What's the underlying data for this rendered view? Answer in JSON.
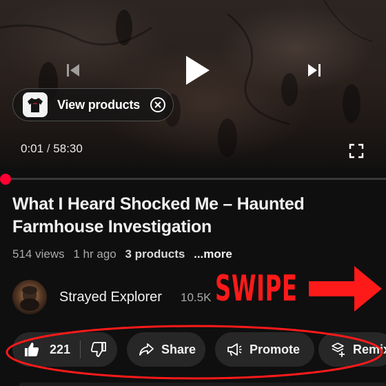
{
  "player": {
    "current_time": "0:01",
    "separator": "/",
    "duration": "58:30",
    "view_products_label": "View products",
    "progress_fraction": 0.0003
  },
  "video": {
    "title": "What I Heard Shocked Me – Haunted Farmhouse Investigation",
    "views": "514 views",
    "age": "1 hr ago",
    "products": "3 products",
    "more": "...more"
  },
  "channel": {
    "name": "Strayed Explorer",
    "subscribers": "10.5K"
  },
  "actions": {
    "like_count": "221",
    "share_label": "Share",
    "promote_label": "Promote",
    "remix_label": "Remix"
  },
  "overlay": {
    "swipe_text": "SWIPE",
    "color": "#ff1a1a"
  },
  "colors": {
    "background": "#0f0f0f",
    "pill": "#272727",
    "progress": "#ff0000",
    "secondary_text": "#aaaaaa"
  }
}
